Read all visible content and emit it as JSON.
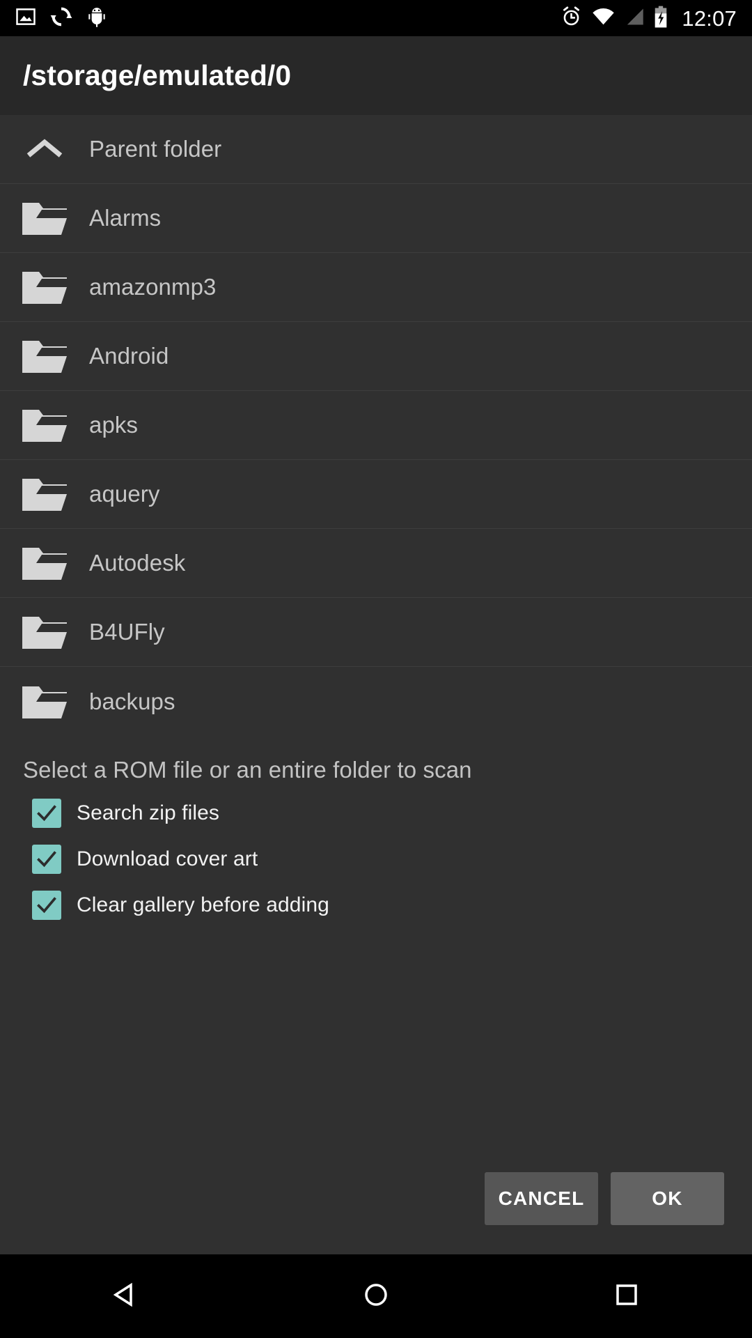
{
  "status_bar": {
    "icons_left": [
      "image-icon",
      "sync-icon",
      "android-debug-icon"
    ],
    "icons_right": [
      "alarm-icon",
      "wifi-icon",
      "signal-icon",
      "battery-charging-icon"
    ],
    "clock": "12:07"
  },
  "title_bar": {
    "path": "/storage/emulated/0"
  },
  "file_list": [
    {
      "label": "Parent folder",
      "icon": "chevron-up-icon"
    },
    {
      "label": "Alarms",
      "icon": "folder-icon"
    },
    {
      "label": "amazonmp3",
      "icon": "folder-icon"
    },
    {
      "label": "Android",
      "icon": "folder-icon"
    },
    {
      "label": "apks",
      "icon": "folder-icon"
    },
    {
      "label": "aquery",
      "icon": "folder-icon"
    },
    {
      "label": "Autodesk",
      "icon": "folder-icon"
    },
    {
      "label": "B4UFly",
      "icon": "folder-icon"
    },
    {
      "label": "backups",
      "icon": "folder-icon"
    }
  ],
  "options": {
    "hint": "Select a ROM file or an entire folder to scan",
    "checkboxes": [
      {
        "label": "Search zip files",
        "checked": true
      },
      {
        "label": "Download cover art",
        "checked": true
      },
      {
        "label": "Clear gallery before adding",
        "checked": true
      }
    ]
  },
  "buttons": {
    "cancel": "CANCEL",
    "ok": "OK"
  },
  "nav_bar": {
    "back": "back-icon",
    "home": "home-icon",
    "recents": "recents-icon"
  },
  "colors": {
    "accent_checkbox": "#80cbc4",
    "background": "#303030",
    "title_bar": "#282828",
    "status_bar": "#000000",
    "text_primary": "#ffffff",
    "text_secondary": "#c6c6c6",
    "divider": "#3d3d3d",
    "btn_cancel": "#565656",
    "btn_ok": "#636363"
  }
}
